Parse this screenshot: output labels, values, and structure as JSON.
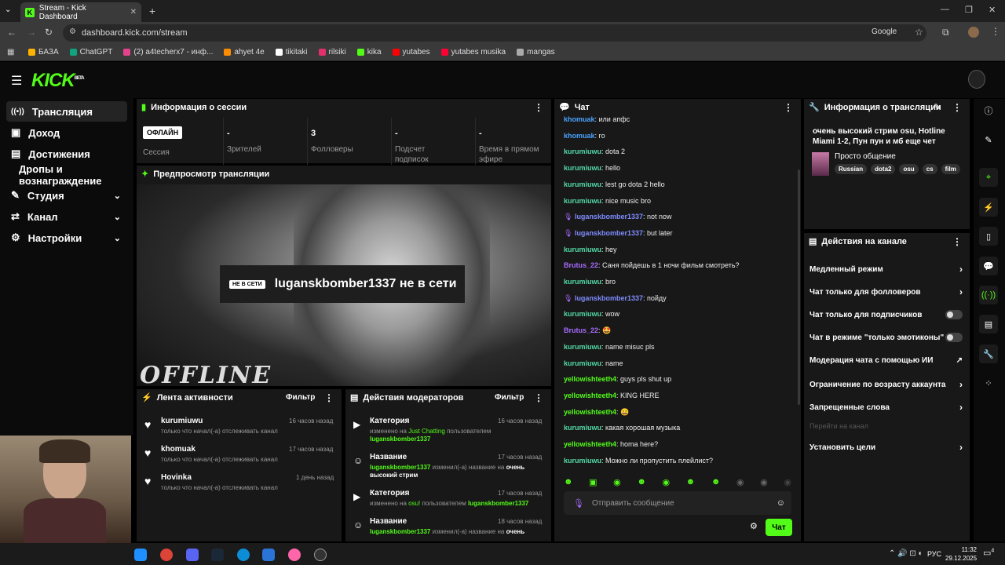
{
  "browser": {
    "tab_title": "Stream - Kick Dashboard",
    "url": "dashboard.kick.com/stream",
    "search_engine": "Google",
    "bookmarks": [
      "БАЗА",
      "ChatGPT",
      "(2) a4techerx7 - инф...",
      "ahyet 4e",
      "tikitaki",
      "rilsiki",
      "kika",
      "yutabes",
      "yutabes musika",
      "mangas"
    ]
  },
  "kick": {
    "logo": "KICK",
    "logo_beta": "BETA"
  },
  "sidebar": {
    "items": [
      {
        "label": "Трансляция"
      },
      {
        "label": "Доход"
      },
      {
        "label": "Достижения"
      },
      {
        "label": "Дропы и вознаграждение"
      },
      {
        "label": "Студия"
      },
      {
        "label": "Канал"
      },
      {
        "label": "Настройки"
      }
    ]
  },
  "session": {
    "title": "Информация о сессии",
    "status_badge": "ОФЛАЙН",
    "stats": [
      {
        "value": "",
        "label": "Сессия"
      },
      {
        "value": "-",
        "label": "Зрителей"
      },
      {
        "value": "3",
        "label": "Фолловеры"
      },
      {
        "value": "-",
        "label": "Подсчет подписок"
      },
      {
        "value": "-",
        "label": "Время в прямом эфире"
      }
    ]
  },
  "preview": {
    "title": "Предпросмотр трансляции",
    "offline_badge": "НЕ В СЕТИ",
    "offline_text": "luganskbomber1337 не в сети",
    "offline_overlay": "OFFLINE"
  },
  "activity": {
    "title": "Лента активности",
    "filter": "Фильтр",
    "items": [
      {
        "user": "kurumiuwu",
        "time": "16 часов назад",
        "text": "только что начал(-а) отслеживать канал"
      },
      {
        "user": "khomuak",
        "time": "17 часов назад",
        "text": "только что начал(-а) отслеживать канал"
      },
      {
        "user": "Hovinka",
        "time": "1 день назад",
        "text": "только что начал(-а) отслеживать канал"
      }
    ]
  },
  "modactions": {
    "title": "Действия модераторов",
    "filter": "Фильтр",
    "items": [
      {
        "type": "Категория",
        "time": "16 часов назад",
        "l1a": "изменено на ",
        "l1b": "Just Chatting",
        "l1c": " пользователем",
        "l2a": "luganskbomber1337",
        "l2b": ""
      },
      {
        "type": "Название",
        "time": "17 часов назад",
        "l1a": "",
        "l1b": "luganskbomber1337",
        "l1c": " изменил(-а) название на ",
        "l1d": "очень",
        "l2a": "",
        "l2b": "высокий стрим"
      },
      {
        "type": "Категория",
        "time": "17 часов назад",
        "l1a": "изменено на ",
        "l1b": "osu!",
        "l1c": " пользователем ",
        "l1d": "luganskbomber1337",
        "l2a": "",
        "l2b": ""
      },
      {
        "type": "Название",
        "time": "18 часов назад",
        "l1a": "",
        "l1b": "luganskbomber1337",
        "l1c": " изменил(-а) название на ",
        "l1d": "очень",
        "l2a": "",
        "l2b": ""
      }
    ]
  },
  "chat": {
    "title": "Чат",
    "placeholder": "Отправить сообщение",
    "send": "Чат",
    "messages": [
      {
        "user": "khomuak",
        "color": "#4aa3ff",
        "text": "или апфс",
        "badge": false
      },
      {
        "user": "khomuak",
        "color": "#4aa3ff",
        "text": "го",
        "badge": false
      },
      {
        "user": "kurumiuwu",
        "color": "#53d9a7",
        "text": "dota 2",
        "badge": false
      },
      {
        "user": "kurumiuwu",
        "color": "#53d9a7",
        "text": "hello",
        "badge": false
      },
      {
        "user": "kurumiuwu",
        "color": "#53d9a7",
        "text": "lest go dota 2 hello",
        "badge": false
      },
      {
        "user": "kurumiuwu",
        "color": "#53d9a7",
        "text": "nice music bro",
        "badge": false
      },
      {
        "user": "luganskbomber1337",
        "color": "#7f8cff",
        "text": "not now",
        "badge": true
      },
      {
        "user": "luganskbomber1337",
        "color": "#7f8cff",
        "text": "but later",
        "badge": true
      },
      {
        "user": "kurumiuwu",
        "color": "#53d9a7",
        "text": "hey",
        "badge": false
      },
      {
        "user": "Brutus_22",
        "color": "#a86cff",
        "text": "Саня пойдешь в 1 ночи фильм смотреть?",
        "badge": false
      },
      {
        "user": "kurumiuwu",
        "color": "#53d9a7",
        "text": "bro",
        "badge": false
      },
      {
        "user": "luganskbomber1337",
        "color": "#7f8cff",
        "text": "пойду",
        "badge": true
      },
      {
        "user": "kurumiuwu",
        "color": "#53d9a7",
        "text": "wow",
        "badge": false
      },
      {
        "user": "Brutus_22",
        "color": "#a86cff",
        "text": "🤩",
        "badge": false
      },
      {
        "user": "kurumiuwu",
        "color": "#53d9a7",
        "text": "name misuc pls",
        "badge": false
      },
      {
        "user": "kurumiuwu",
        "color": "#53d9a7",
        "text": "name",
        "badge": false
      },
      {
        "user": "yellowishteeth4",
        "color": "#53fc18",
        "text": "guys pls shut up",
        "badge": false
      },
      {
        "user": "yellowishteeth4",
        "color": "#53fc18",
        "text": "KING HERE",
        "badge": false
      },
      {
        "user": "yellowishteeth4",
        "color": "#53fc18",
        "text": "😄",
        "badge": false
      },
      {
        "user": "kurumiuwu",
        "color": "#53d9a7",
        "text": "какая хорошая музыка",
        "badge": false
      },
      {
        "user": "yellowishteeth4",
        "color": "#53fc18",
        "text": "homa here?",
        "badge": false
      },
      {
        "user": "kurumiuwu",
        "color": "#53d9a7",
        "text": "Можно ли пропустить плейлист?",
        "badge": false
      }
    ]
  },
  "stream_info": {
    "title": "Информация о трансляции",
    "stream_title": "очень высокий стрим osu, Hotline Miami 1-2, Пун пун и мб еще чет",
    "category": "Просто общение",
    "tags": [
      "Russian",
      "dota2",
      "osu",
      "cs",
      "film"
    ]
  },
  "channel_actions": {
    "title": "Действия на канале",
    "items": [
      {
        "label": "Медленный режим",
        "kind": "chevron"
      },
      {
        "label": "Чат только для фолловеров",
        "kind": "chevron"
      },
      {
        "label": "Чат только для подписчиков",
        "kind": "toggle"
      },
      {
        "label": "Чат в режиме \"только эмотиконы\"",
        "kind": "toggle"
      },
      {
        "label": "Модерация чата с помощью ИИ",
        "kind": "external"
      },
      {
        "label": "Ограничение по возрасту аккаунта",
        "kind": "chevron"
      },
      {
        "label": "Запрещенные слова",
        "kind": "chevron"
      },
      {
        "label": "Перейти на канал",
        "kind": "disabled"
      },
      {
        "label": "Установить цели",
        "kind": "chevron"
      }
    ]
  },
  "taskbar": {
    "lang": "РУС",
    "time": "11:32",
    "date": "29.12.2025",
    "notif_count": "4"
  },
  "colors": {
    "accent": "#53fc18",
    "panel": "#181818",
    "bg": "#000000"
  }
}
